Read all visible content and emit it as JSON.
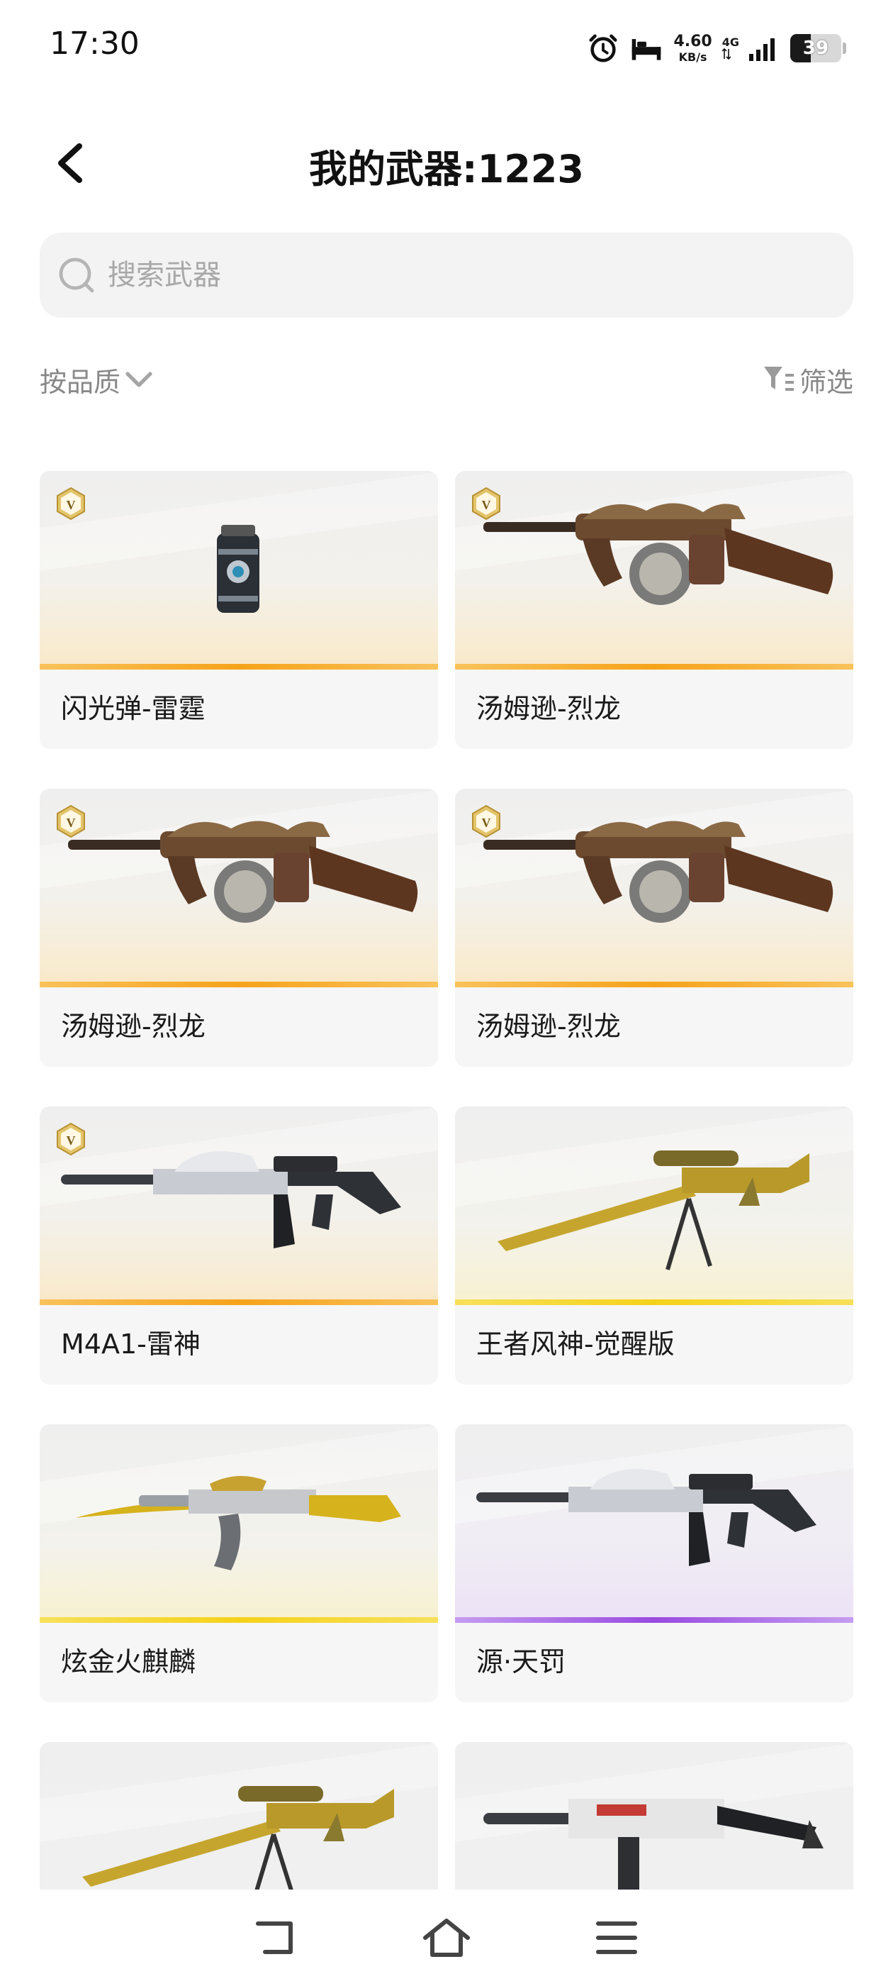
{
  "status_bar": {
    "time": "17:30",
    "speed_value": "4.60",
    "speed_unit": "KB/s",
    "network": "4G",
    "battery": "39"
  },
  "header": {
    "title": "我的武器:1223"
  },
  "search": {
    "placeholder": "搜索武器",
    "value": ""
  },
  "toolbar": {
    "sort_label": "按品质",
    "filter_label": "筛选"
  },
  "weapons": [
    {
      "name": "闪光弹-雷霆",
      "vip": true,
      "rarity": "orange",
      "icon": "grenade"
    },
    {
      "name": "汤姆逊-烈龙",
      "vip": true,
      "rarity": "orange",
      "icon": "tommy-gun"
    },
    {
      "name": "汤姆逊-烈龙",
      "vip": true,
      "rarity": "orange",
      "icon": "tommy-gun"
    },
    {
      "name": "汤姆逊-烈龙",
      "vip": true,
      "rarity": "orange",
      "icon": "tommy-gun"
    },
    {
      "name": "M4A1-雷神",
      "vip": true,
      "rarity": "orange",
      "icon": "rifle"
    },
    {
      "name": "王者风神-觉醒版",
      "vip": false,
      "rarity": "yellow",
      "icon": "sniper"
    },
    {
      "name": "炫金火麒麟",
      "vip": false,
      "rarity": "yellow",
      "icon": "ak"
    },
    {
      "name": "源·天罚",
      "vip": false,
      "rarity": "purple",
      "icon": "rifle"
    },
    {
      "name": "",
      "vip": false,
      "rarity": "plain",
      "icon": "sniper"
    },
    {
      "name": "",
      "vip": false,
      "rarity": "plain",
      "icon": "smg"
    }
  ],
  "colors": {
    "orange_bar": "#f6a31a",
    "yellow_bar": "#f5d21a",
    "purple_bar": "#9a4be0"
  }
}
